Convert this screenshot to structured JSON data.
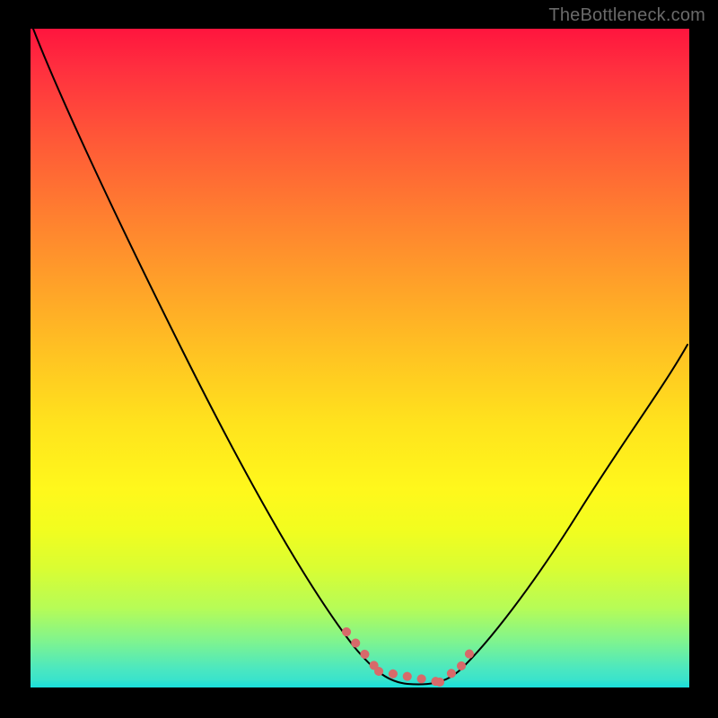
{
  "watermark": "TheBottleneck.com",
  "chart_data": {
    "type": "line",
    "title": "",
    "xlabel": "",
    "ylabel": "",
    "xlim": [
      0,
      100
    ],
    "ylim": [
      0,
      100
    ],
    "grid": false,
    "legend": false,
    "series": [
      {
        "name": "curve",
        "x": [
          0,
          5,
          10,
          15,
          20,
          25,
          30,
          35,
          40,
          45,
          50,
          52,
          55,
          58,
          60,
          62,
          65,
          70,
          75,
          80,
          85,
          90,
          95,
          100
        ],
        "y": [
          100,
          93,
          85,
          77,
          69,
          61,
          52,
          44,
          35,
          25,
          12,
          6,
          2,
          0.5,
          0.2,
          0.2,
          1,
          5,
          12,
          20,
          29,
          38,
          46,
          53
        ]
      }
    ],
    "highlight": {
      "name": "dotted-trough",
      "x": [
        48,
        50,
        52,
        54,
        56,
        58,
        60,
        62,
        63,
        64,
        65
      ],
      "y": [
        11,
        7,
        4,
        2,
        1,
        0.5,
        0.3,
        0.3,
        0.6,
        1.4,
        3
      ]
    },
    "colors": {
      "curve": "#000000",
      "highlight": "#d76a6a",
      "gradient_top": "#ff153e",
      "gradient_bottom": "#2ee0d5",
      "frame": "#000000"
    }
  }
}
